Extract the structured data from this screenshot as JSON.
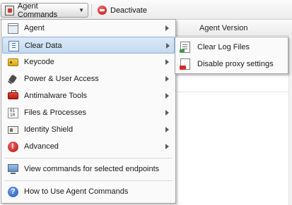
{
  "toolbar": {
    "agent_commands_label": "Agent Commands",
    "deactivate_label": "Deactivate"
  },
  "grid": {
    "agent_version_header": "Agent Version"
  },
  "menu": {
    "items": [
      {
        "label": "Agent",
        "icon": "window-icon",
        "has_submenu": true
      },
      {
        "label": "Clear Data",
        "icon": "clear-data-icon",
        "has_submenu": true,
        "active": true
      },
      {
        "label": "Keycode",
        "icon": "key-icon",
        "has_submenu": true
      },
      {
        "label": "Power & User Access",
        "icon": "plug-icon",
        "has_submenu": true
      },
      {
        "label": "Antimalware Tools",
        "icon": "toolbox-icon",
        "has_submenu": true
      },
      {
        "label": "Files & Processes",
        "icon": "binary-file-icon",
        "has_submenu": true
      },
      {
        "label": "Identity Shield",
        "icon": "id-card-icon",
        "has_submenu": true
      },
      {
        "label": "Advanced",
        "icon": "warning-icon",
        "has_submenu": true
      },
      {
        "label": "View commands for selected endpoints",
        "icon": "monitor-icon",
        "has_submenu": false
      },
      {
        "label": "How to Use Agent Commands",
        "icon": "help-icon",
        "has_submenu": false
      }
    ]
  },
  "submenu": {
    "items": [
      {
        "label": "Clear Log Files",
        "icon": "log-file-icon"
      },
      {
        "label": "Disable proxy settings",
        "icon": "proxy-settings-icon"
      }
    ]
  },
  "colors": {
    "active_item_bg": "#c4d9f0",
    "active_item_border": "#8bb0d9",
    "menu_bg": "#fafafa",
    "menu_border": "#a8a8a8"
  }
}
